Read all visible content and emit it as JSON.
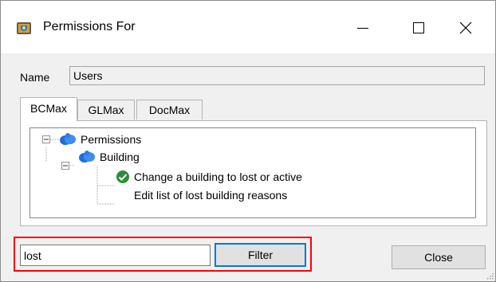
{
  "window": {
    "title": "Permissions For",
    "icon": "app-shield-icon",
    "controls": [
      "minimize-icon",
      "maximize-icon",
      "close-icon"
    ]
  },
  "name_row": {
    "label": "Name",
    "value": "Users"
  },
  "tabs": [
    {
      "label": "BCMax",
      "active": true
    },
    {
      "label": "GLMax",
      "active": false
    },
    {
      "label": "DocMax",
      "active": false
    }
  ],
  "tree": {
    "root": {
      "label": "Permissions",
      "icon": "users-folder-icon",
      "expanded": true
    },
    "child": {
      "label": "Building",
      "icon": "users-folder-icon",
      "expanded": true
    },
    "leaves": [
      {
        "label": "Change a building to lost or active",
        "checked": true,
        "icon": "green-check-icon"
      },
      {
        "label": "Edit list of lost building reasons",
        "checked": false
      }
    ]
  },
  "filter": {
    "value": "lost",
    "button_label": "Filter"
  },
  "close_label": "Close",
  "colors": {
    "accent": "#0078d7",
    "highlight": "#ff0000",
    "check": "#2e8b3a",
    "folder": "#1e6fd9"
  }
}
